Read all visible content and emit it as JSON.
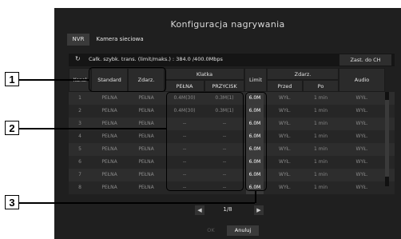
{
  "dialog": {
    "title": "Konfiguracja nagrywania"
  },
  "tabs": [
    {
      "label": "NVR"
    },
    {
      "label": "Kamera sieciowa"
    }
  ],
  "info": {
    "speed_text": "Całk. szybk. trans. (limit/maks.) : 384.0 /400.0Mbps",
    "apply_ch_label": "Zast. do CH"
  },
  "headers": {
    "kanal": "Kanał",
    "standard": "Standard",
    "zdarz": "Zdarz.",
    "klatka": "Klatka",
    "pelna": "PEŁNA",
    "przycisk": "PRZYCISK",
    "limit": "Limit",
    "zdarz_group": "Zdarz.",
    "przed": "Przed",
    "po": "Po",
    "audio": "Audio"
  },
  "rows": [
    {
      "ch": "1",
      "standard": "PEŁNA",
      "zdarz": "PEŁNA",
      "pelna": "0.4M(30)",
      "przycisk": "0.3M(1)",
      "limit": "6.0M",
      "przed": "WYŁ.",
      "po": "1 min",
      "audio": "WYŁ."
    },
    {
      "ch": "2",
      "standard": "PEŁNA",
      "zdarz": "PEŁNA",
      "pelna": "0.4M(30)",
      "przycisk": "0.3M(1)",
      "limit": "6.0M",
      "przed": "WYŁ.",
      "po": "1 min",
      "audio": "WYŁ."
    },
    {
      "ch": "3",
      "standard": "PEŁNA",
      "zdarz": "PEŁNA",
      "pelna": "--",
      "przycisk": "--",
      "limit": "6.0M",
      "przed": "WYŁ.",
      "po": "1 min",
      "audio": "WYŁ."
    },
    {
      "ch": "4",
      "standard": "PEŁNA",
      "zdarz": "PEŁNA",
      "pelna": "--",
      "przycisk": "--",
      "limit": "6.0M",
      "przed": "WYŁ.",
      "po": "1 min",
      "audio": "WYŁ."
    },
    {
      "ch": "5",
      "standard": "PEŁNA",
      "zdarz": "PEŁNA",
      "pelna": "--",
      "przycisk": "--",
      "limit": "6.0M",
      "przed": "WYŁ.",
      "po": "1 min",
      "audio": "WYŁ."
    },
    {
      "ch": "6",
      "standard": "PEŁNA",
      "zdarz": "PEŁNA",
      "pelna": "--",
      "przycisk": "--",
      "limit": "6.0M",
      "przed": "WYŁ.",
      "po": "1 min",
      "audio": "WYŁ."
    },
    {
      "ch": "7",
      "standard": "PEŁNA",
      "zdarz": "PEŁNA",
      "pelna": "--",
      "przycisk": "--",
      "limit": "6.0M",
      "przed": "WYŁ.",
      "po": "1 min",
      "audio": "WYŁ."
    },
    {
      "ch": "8",
      "standard": "PEŁNA",
      "zdarz": "PEŁNA",
      "pelna": "--",
      "przycisk": "--",
      "limit": "6.0M",
      "przed": "WYŁ.",
      "po": "1 min",
      "audio": "WYŁ."
    }
  ],
  "pager": {
    "text": "1/8"
  },
  "footer": {
    "ok": "OK",
    "cancel": "Anuluj"
  },
  "callouts": {
    "one": "1",
    "two": "2",
    "three": "3"
  }
}
